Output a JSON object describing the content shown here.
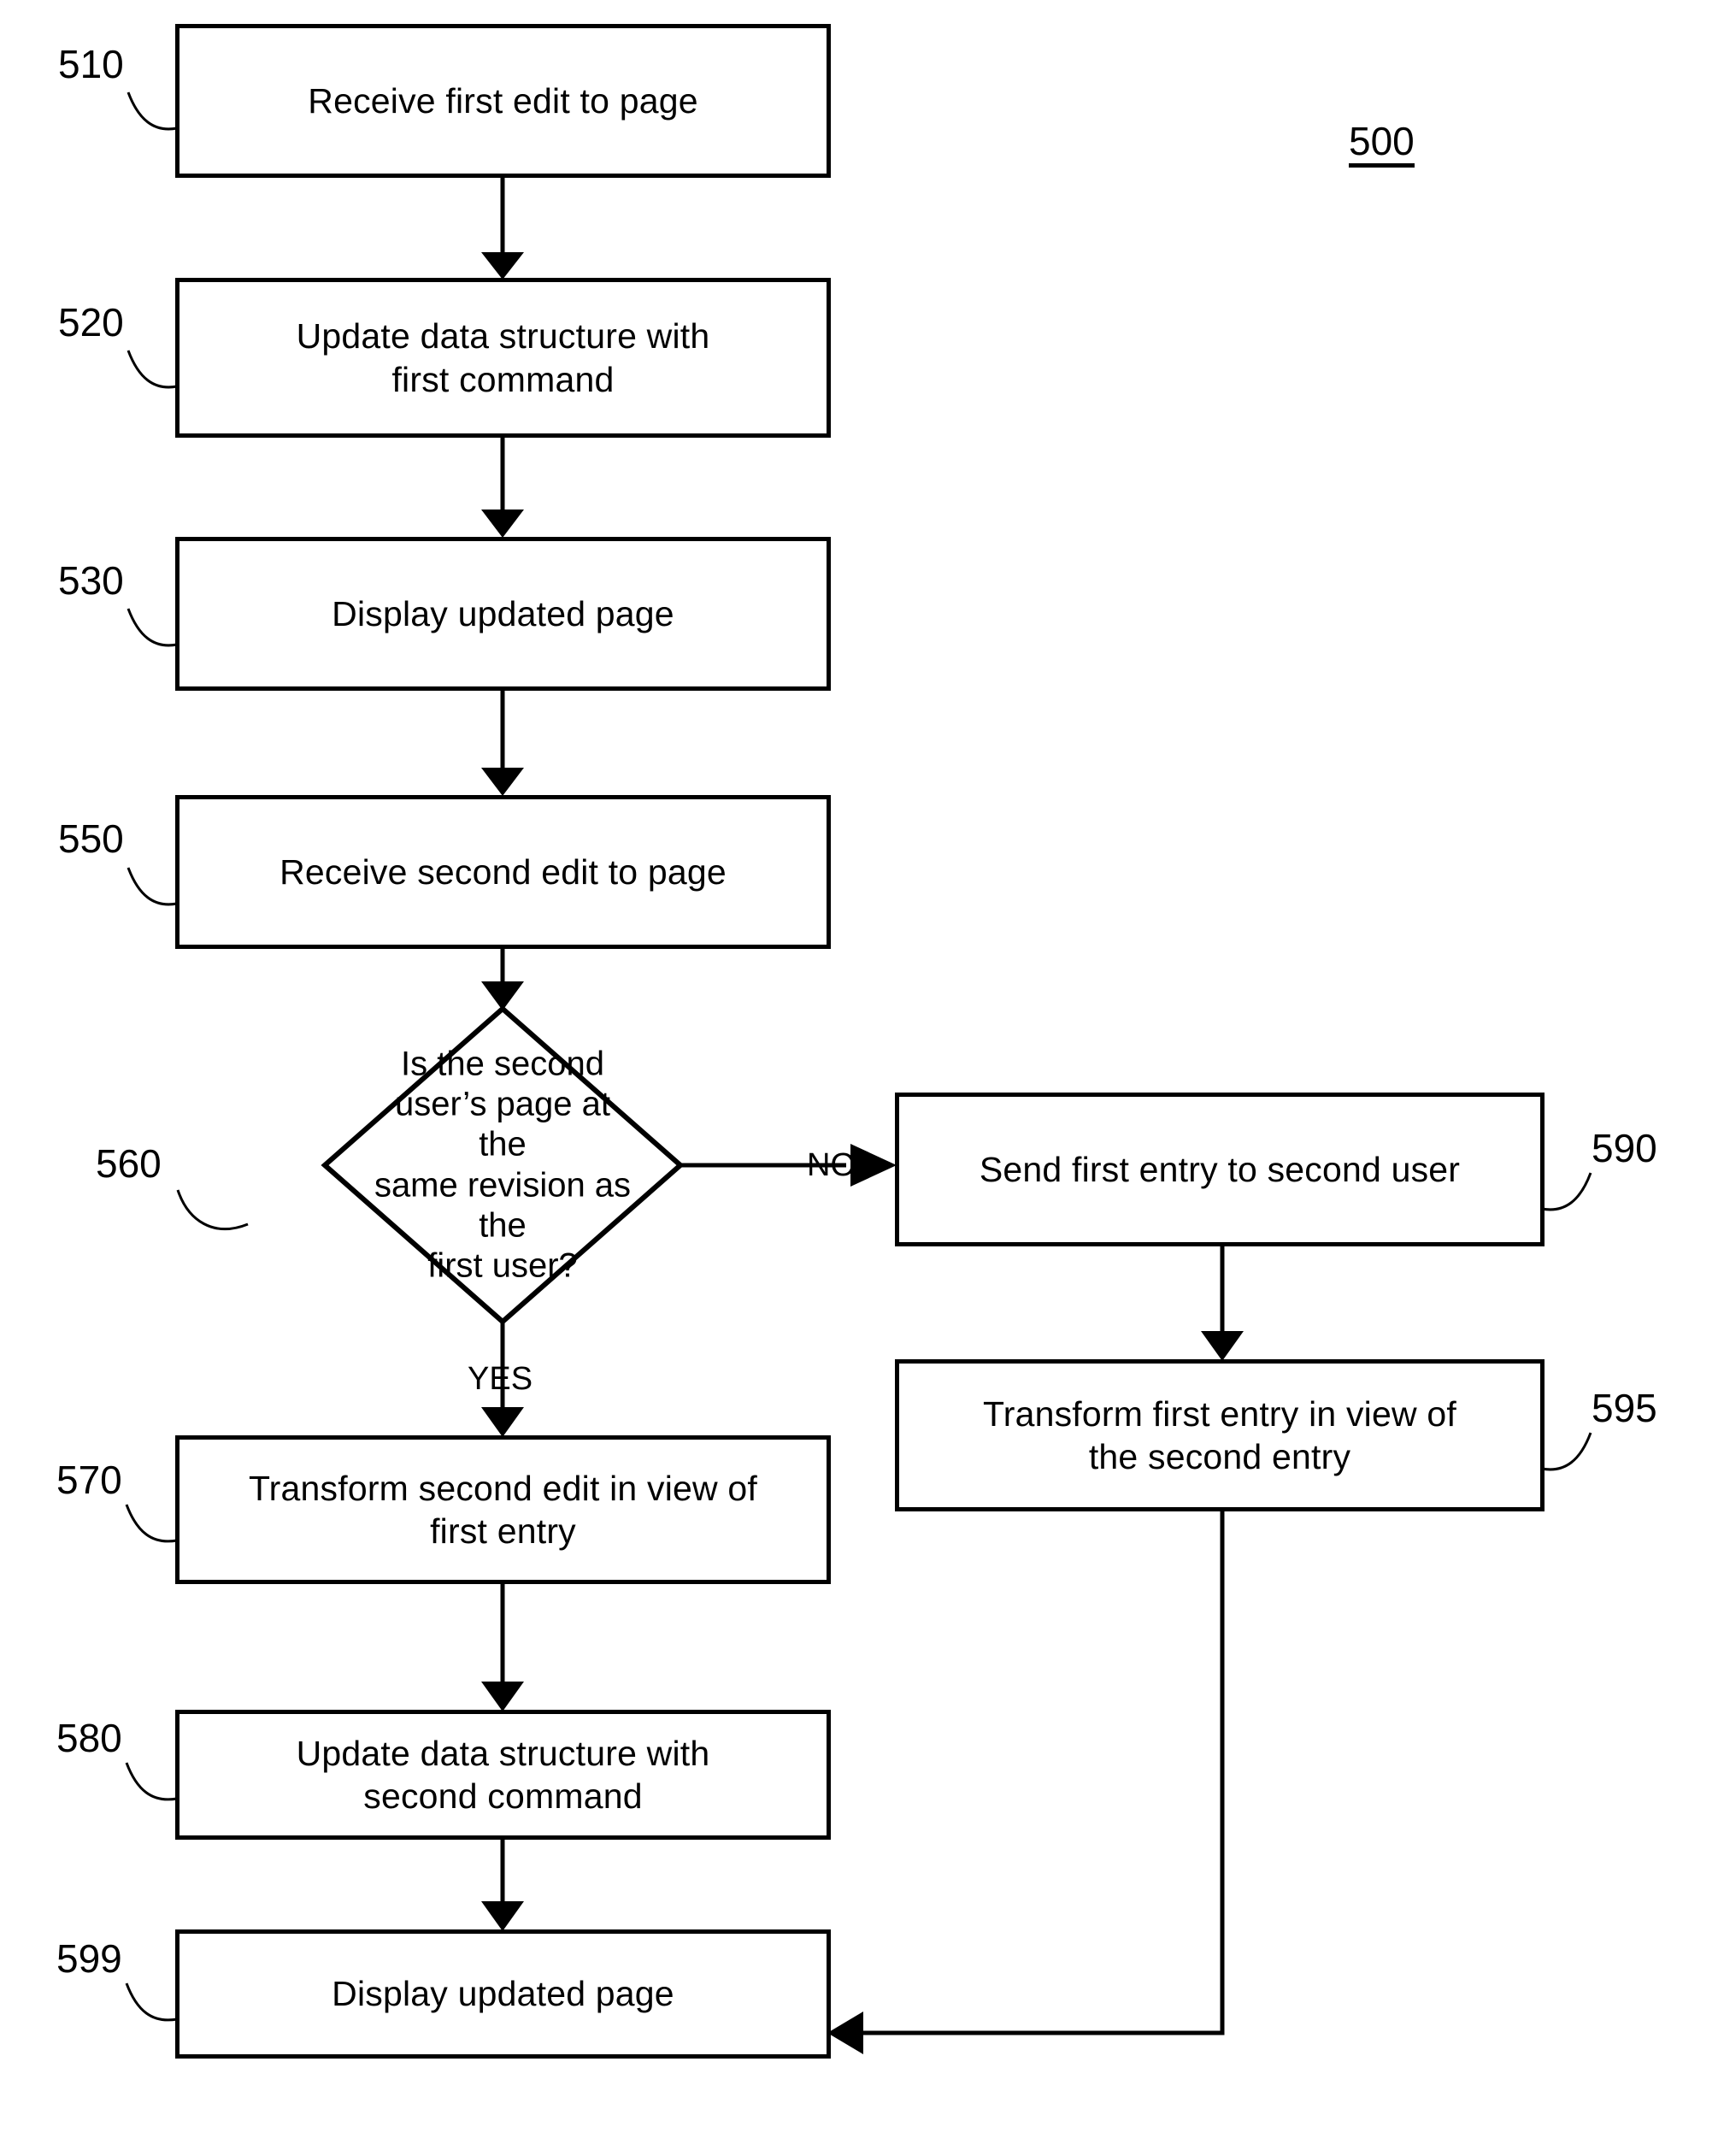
{
  "figure": {
    "number": "500",
    "type": "flowchart"
  },
  "nodes": [
    {
      "ref": "510",
      "label": "Receive first edit to page"
    },
    {
      "ref": "520",
      "label": "Update data structure with\nfirst command"
    },
    {
      "ref": "530",
      "label": "Display updated page"
    },
    {
      "ref": "550",
      "label": "Receive second edit to page"
    },
    {
      "ref": "560",
      "label": "Is the second\nuser’s page at the\nsame revision as the\nfirst user?"
    },
    {
      "ref": "570",
      "label": "Transform second edit in view of\nfirst entry"
    },
    {
      "ref": "580",
      "label": "Update data structure with\nsecond command"
    },
    {
      "ref": "590",
      "label": "Send first entry to second user"
    },
    {
      "ref": "595",
      "label": "Transform first entry in view of\nthe second entry"
    },
    {
      "ref": "599",
      "label": "Display updated page"
    }
  ],
  "edge_labels": {
    "no": "NO",
    "yes": "YES"
  },
  "colors": {
    "stroke": "#000000",
    "fill": "#ffffff"
  }
}
